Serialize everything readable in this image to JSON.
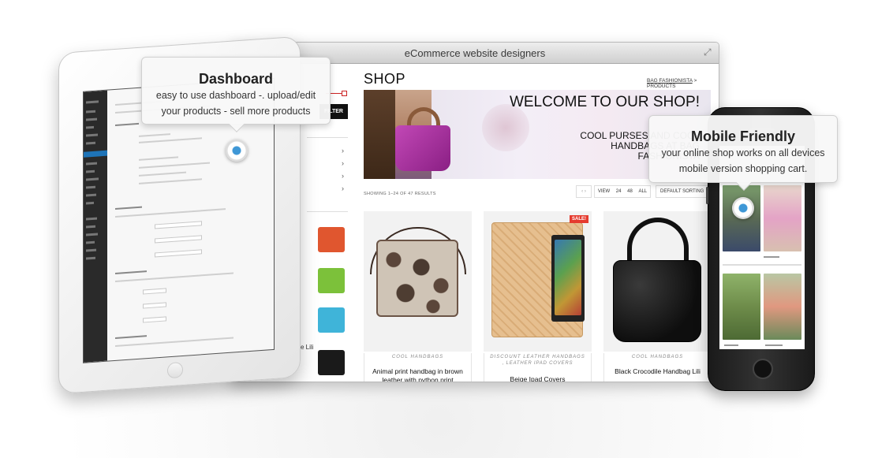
{
  "browser": {
    "title": "eCommerce website designers",
    "shop_title": "SHOP",
    "breadcrumb_link": "BAG FASHIONISTA",
    "breadcrumb_rest": " > PRODUCTS",
    "filter_label": "FILTER",
    "banner_heading": "WELCOME TO OUR SHOP!",
    "banner_sub": "COOL PURSES AND COOL HANDBAGS AT BAG FASHIONISTA",
    "showing_text": "SHOWING 1–24 OF 47 RESULTS",
    "view_arrows": "‹ ›",
    "view_label": "VIEW",
    "view_options": [
      "24",
      "48",
      "ALL"
    ],
    "sort_label": "DEFAULT SORTING  ⌄",
    "sidebar_partial_text": "e Lili",
    "sidebar_thumb_colors": [
      "#e0562f",
      "#7cc13a",
      "#3fb4d9",
      "#1a1a1a"
    ],
    "products": [
      {
        "category": "COOL HANDBAGS",
        "category2": "",
        "name": "Animal print handbag in brown leather with python print",
        "sale": ""
      },
      {
        "category": "DISCOUNT LEATHER HANDBAGS",
        "category2": ", LEATHER IPAD COVERS",
        "name": "Beige Ipad Covers",
        "sale": "SALE!"
      },
      {
        "category": "COOL HANDBAGS",
        "category2": "",
        "name": "Black Crocodile Handbag Lili",
        "sale": ""
      }
    ]
  },
  "tooltips": {
    "dashboard": {
      "title": "Dashboard",
      "line1": "easy to use dashboard -. upload/edit",
      "line2": "your products - sell more products"
    },
    "mobile": {
      "title": "Mobile Friendly",
      "line1": "your online shop works on all devices",
      "line2": "mobile version shopping cart."
    }
  },
  "colors": {
    "accent_blue": "#3e97d6",
    "sale_red": "#e53b2f",
    "admin_sidebar": "#2a2a2a"
  }
}
